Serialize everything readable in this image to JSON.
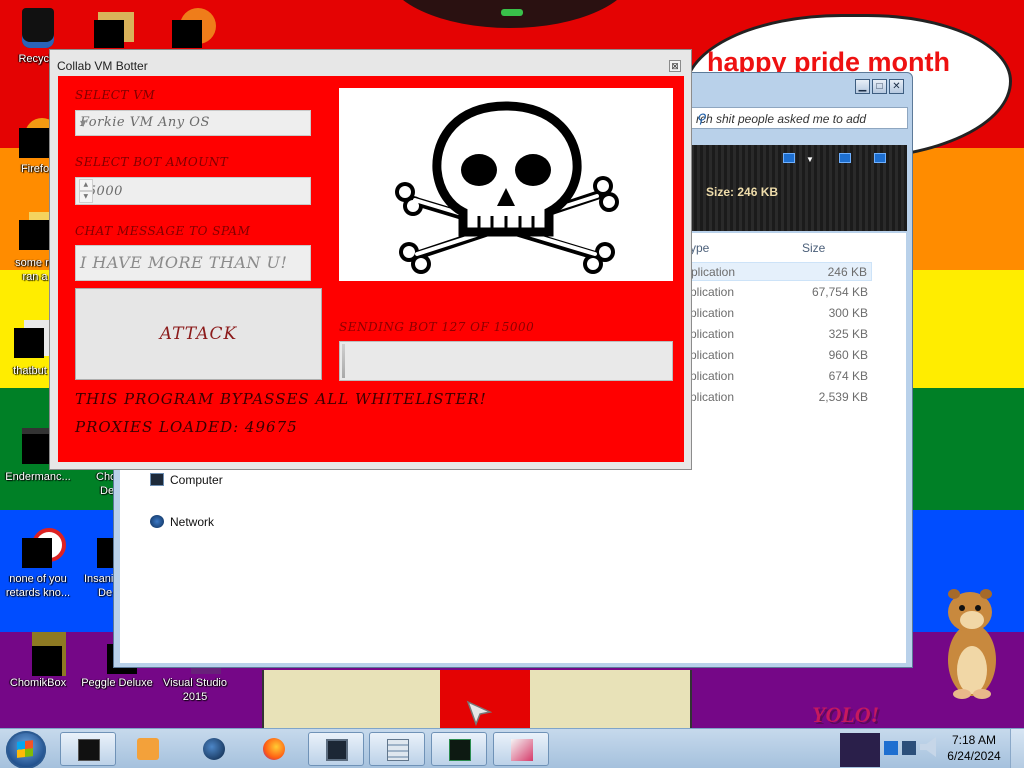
{
  "desktop": {
    "speech_bubble": "happy pride month",
    "sticker_text": "YOLO!",
    "icons": [
      {
        "label": "Recycle",
        "icon": "recycle-bin-icon"
      },
      {
        "label": "",
        "icon": "folder-icon"
      },
      {
        "label": "",
        "icon": "media-icon"
      },
      {
        "label": "Firefo",
        "icon": "firefox-icon"
      },
      {
        "label": "some ru",
        "label2": "ran a",
        "icon": "file-icon"
      },
      {
        "label": "thatbut",
        "icon": "file-icon"
      },
      {
        "label": "Endermanc...",
        "icon": "app-icon"
      },
      {
        "label": "Cho",
        "label2": "De",
        "icon": "app-icon"
      },
      {
        "label": "none of you",
        "label2": "retards kno...",
        "icon": "app-icon"
      },
      {
        "label": "Insani",
        "label2": "De",
        "icon": "app-icon"
      },
      {
        "label": "ChomikBox",
        "icon": "chomikbox-icon"
      },
      {
        "label": "Peggle Deluxe",
        "icon": "peggle-icon"
      },
      {
        "label": "Visual Studio",
        "label2": "2015",
        "icon": "visual-studio-icon"
      }
    ]
  },
  "explorer": {
    "search_placeholder": "rch shit people asked me to add",
    "preview_size": "Size: 246 KB",
    "columns": {
      "type": "ype",
      "size": "Size"
    },
    "files": [
      {
        "type": "plication",
        "size": "246 KB"
      },
      {
        "type": "plication",
        "size": "67,754 KB"
      },
      {
        "type": "plication",
        "size": "300 KB"
      },
      {
        "type": "plication",
        "size": "325 KB"
      },
      {
        "type": "plication",
        "size": "960 KB"
      },
      {
        "type": "plication",
        "size": "674 KB"
      },
      {
        "type": "plication",
        "size": "2,539 KB"
      }
    ],
    "nav": [
      {
        "label": "Computer"
      },
      {
        "label": "Network"
      }
    ]
  },
  "botter": {
    "title": "Collab VM Botter",
    "close_glyph": "⊠",
    "select_vm_label": "SELECT VM",
    "select_vm_value": "Forkie VM Any OS",
    "bot_amount_label": "SELECT BOT AMOUNT",
    "bot_amount_value": "15000",
    "chat_label": "CHAT MESSAGE TO SPAM",
    "chat_value": "I HAVE MORE THAN U!",
    "attack_label": "ATTACK",
    "sending_text": "SENDING BOT 127 OF 15000",
    "progress_fraction": 0.0085,
    "bypass_text": "THIS PROGRAM BYPASSES ALL WHITELISTER!",
    "proxies_text": "PROXIES LOADED: 49675"
  },
  "taskbar": {
    "clock_time": "7:18 AM",
    "clock_date": "6/24/2024",
    "items": [
      {
        "name": "taskbar-cmd",
        "icon": "terminal-icon",
        "open": true
      },
      {
        "name": "taskbar-media",
        "icon": "media-player-icon",
        "open": false
      },
      {
        "name": "taskbar-globe",
        "icon": "globe-icon",
        "open": false
      },
      {
        "name": "taskbar-firefox",
        "icon": "firefox-icon",
        "open": false
      },
      {
        "name": "taskbar-app1",
        "icon": "monitor-icon",
        "open": true
      },
      {
        "name": "taskbar-calc",
        "icon": "calculator-icon",
        "open": true
      },
      {
        "name": "taskbar-app2",
        "icon": "task-manager-icon",
        "open": true
      },
      {
        "name": "taskbar-app3",
        "icon": "paint-icon",
        "open": true
      }
    ]
  },
  "colors": {
    "botter_red": "#ff0000",
    "label_dark_red": "#800000",
    "taskbar": "#b9d1ea"
  }
}
